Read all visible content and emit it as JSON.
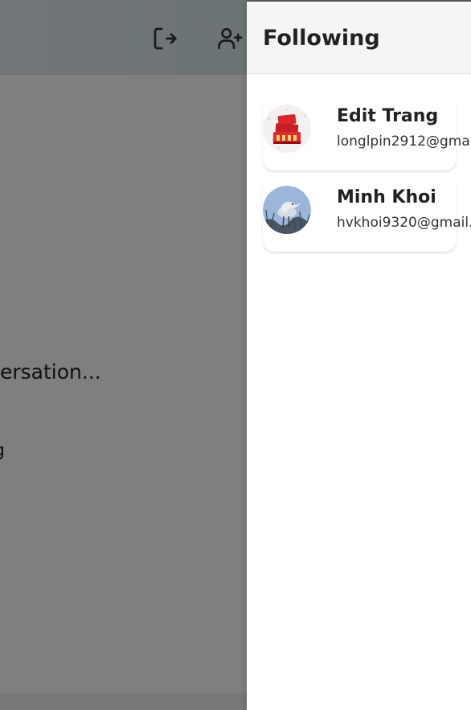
{
  "background": {
    "conversation_placeholder": "ersation...",
    "fragment_text": "g"
  },
  "drawer": {
    "title": "Following",
    "users": [
      {
        "name": "Edit Trang",
        "email": "longlpin2912@gma",
        "avatar_icon": "happy-new-year-avatar"
      },
      {
        "name": "Minh Khoi",
        "email": "hvkhoi9320@gmail.",
        "avatar_icon": "heron-bird-avatar"
      }
    ]
  },
  "colors": {
    "overlay": "rgba(0,0,0,0.5)",
    "drawer_header_bg": "#f5f5f5"
  }
}
